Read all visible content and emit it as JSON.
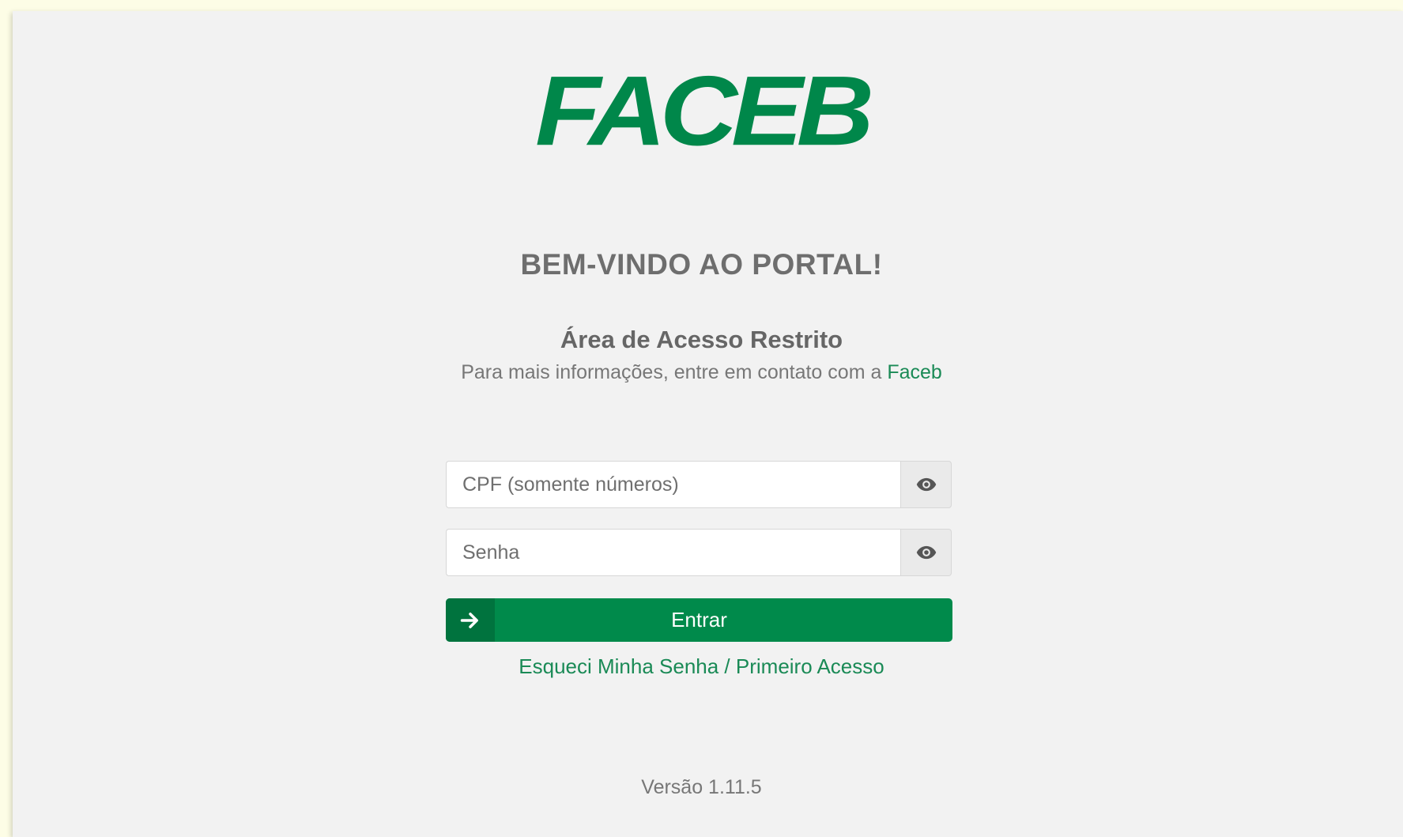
{
  "brand": {
    "logo_text": "FACEB",
    "logo_color": "#00874a"
  },
  "header": {
    "welcome": "BEM-VINDO AO PORTAL!",
    "subtitle": "Área de Acesso Restrito",
    "info_prefix": "Para mais informações, entre em contato com a ",
    "info_link": "Faceb"
  },
  "form": {
    "cpf_placeholder": "CPF (somente números)",
    "cpf_value": "",
    "password_placeholder": "Senha",
    "password_value": "",
    "cpf_toggle_icon": "eye-icon",
    "password_toggle_icon": "eye-icon",
    "submit_icon": "arrow-right-icon",
    "submit_label": "Entrar",
    "forgot_link": "Esqueci Minha Senha / Primeiro Acesso"
  },
  "footer": {
    "version": "Versão 1.11.5"
  },
  "colors": {
    "accent": "#008a4b",
    "accent_dark": "#00733e",
    "background": "#f2f2f2",
    "frame": "#fdfde6"
  }
}
